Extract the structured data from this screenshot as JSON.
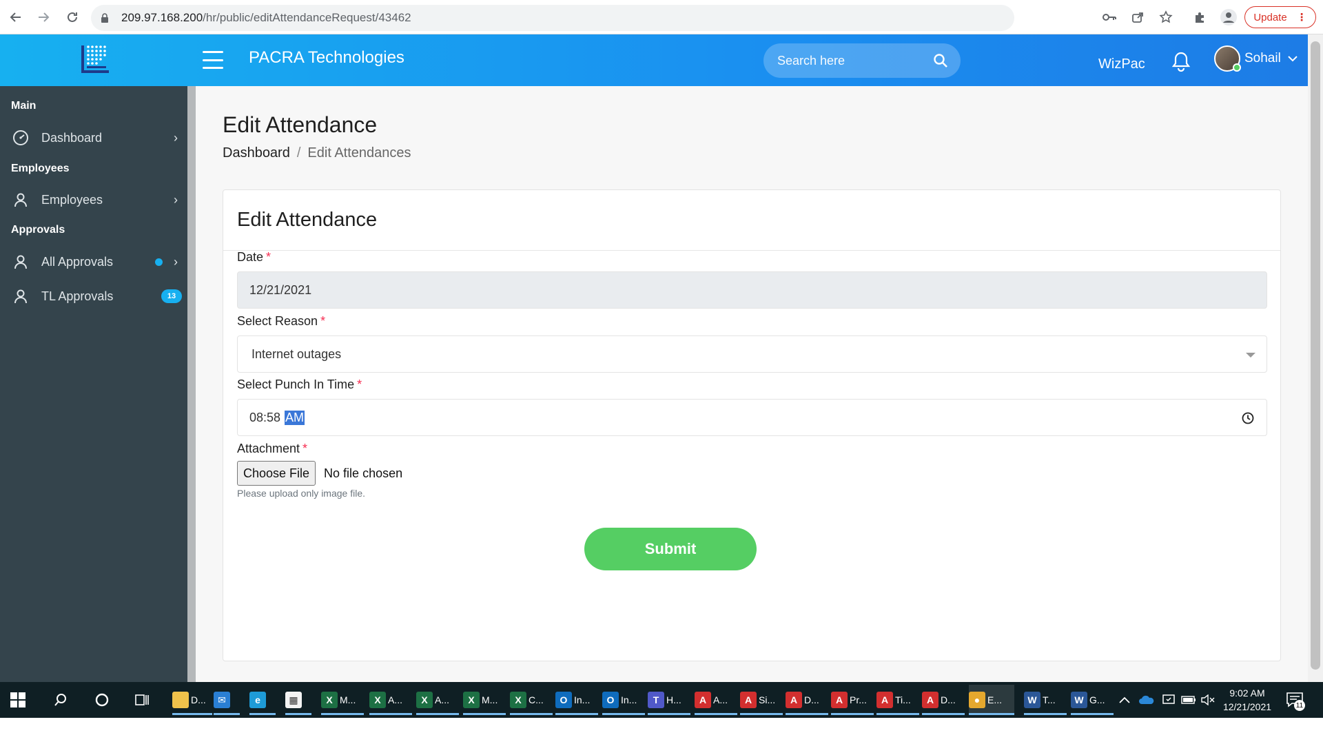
{
  "browser": {
    "url_host": "209.97.168.200",
    "url_path": "/hr/public/editAttendanceRequest/43462",
    "update_label": "Update"
  },
  "header": {
    "company": "PACRA Technologies",
    "search_placeholder": "Search here",
    "wizpac": "WizPac",
    "user_name": "Sohail"
  },
  "sidebar": {
    "sections": {
      "main": "Main",
      "employees": "Employees",
      "approvals": "Approvals"
    },
    "items": [
      {
        "label": "Dashboard"
      },
      {
        "label": "Employees"
      },
      {
        "label": "All Approvals"
      },
      {
        "label": "TL Approvals",
        "badge": "13"
      }
    ]
  },
  "page": {
    "title": "Edit Attendance",
    "breadcrumb": {
      "home": "Dashboard",
      "separator": "/",
      "current": "Edit Attendances"
    }
  },
  "form": {
    "card_title": "Edit Attendance",
    "date": {
      "label": "Date",
      "required": "*",
      "value": "12/21/2021"
    },
    "reason": {
      "label": "Select Reason",
      "required": "*",
      "value": "Internet outages"
    },
    "punch_in": {
      "label": "Select Punch In Time",
      "required": "*",
      "time": "08:58",
      "period": "AM"
    },
    "attachment": {
      "label": "Attachment",
      "required": "*",
      "button": "Choose File",
      "status": "No file chosen",
      "help": "Please upload only image file."
    },
    "submit": "Submit"
  },
  "taskbar": {
    "apps": [
      {
        "label": "D...",
        "icon": "file-explorer-icon"
      },
      {
        "label": "",
        "icon": "mail-icon"
      },
      {
        "label": "",
        "icon": "edge-icon"
      },
      {
        "label": "",
        "icon": "store-icon"
      },
      {
        "label": "M...",
        "icon": "excel-icon"
      },
      {
        "label": "A...",
        "icon": "excel-icon"
      },
      {
        "label": "A...",
        "icon": "excel-icon"
      },
      {
        "label": "M...",
        "icon": "excel-icon"
      },
      {
        "label": "C...",
        "icon": "excel-icon"
      },
      {
        "label": "In...",
        "icon": "outlook-icon"
      },
      {
        "label": "In...",
        "icon": "outlook-icon"
      },
      {
        "label": "H...",
        "icon": "teams-icon"
      },
      {
        "label": "A...",
        "icon": "pdf-icon"
      },
      {
        "label": "Si...",
        "icon": "pdf-icon"
      },
      {
        "label": "D...",
        "icon": "pdf-icon"
      },
      {
        "label": "Pr...",
        "icon": "pdf-icon"
      },
      {
        "label": "Ti...",
        "icon": "pdf-icon"
      },
      {
        "label": "D...",
        "icon": "pdf-icon"
      },
      {
        "label": "E...",
        "icon": "chrome-icon"
      },
      {
        "label": "T...",
        "icon": "word-icon"
      },
      {
        "label": "G...",
        "icon": "word-icon"
      }
    ],
    "time": "9:02 AM",
    "date": "12/21/2021",
    "notification_count": "11"
  },
  "colors": {
    "header_gradient_start": "#17b0f0",
    "header_gradient_end": "#1d7ce6",
    "sidebar_bg": "#34444c",
    "submit_green": "#55ce63",
    "required_red": "#f62d51",
    "badge_blue": "#17b0f0"
  }
}
